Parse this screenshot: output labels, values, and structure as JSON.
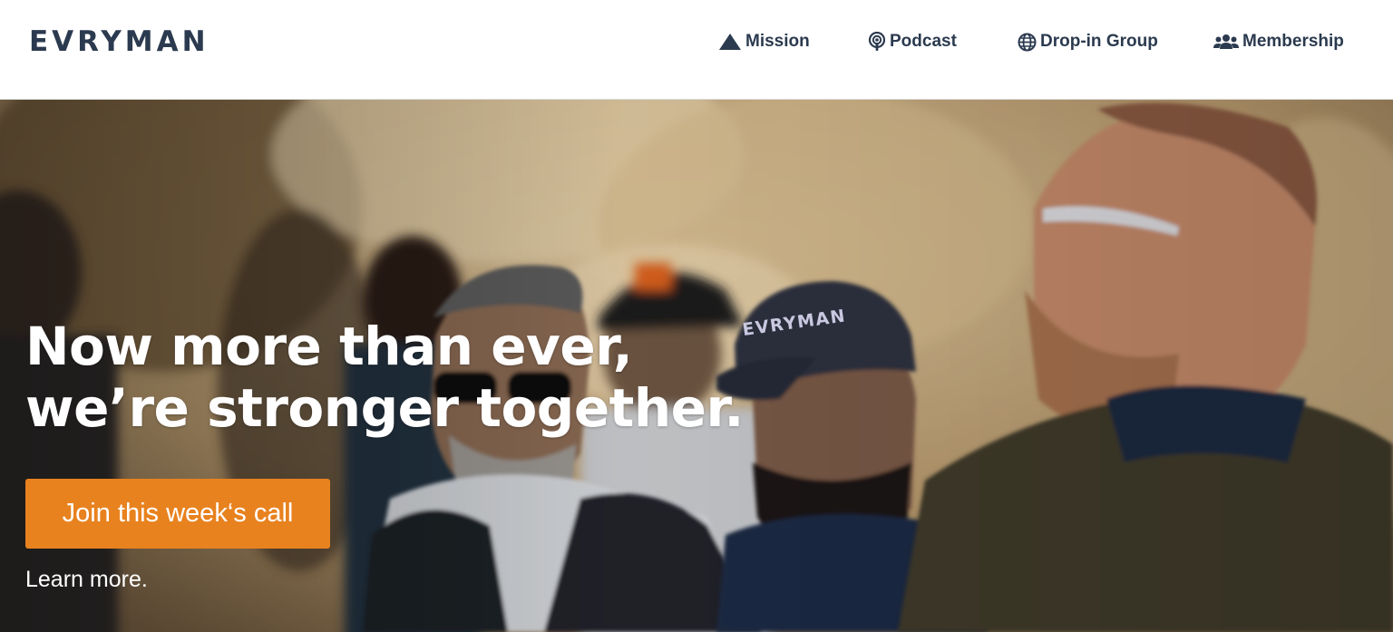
{
  "header": {
    "logo": "EVRYMAN",
    "nav": [
      {
        "label": "Mission",
        "icon": "mountain-icon"
      },
      {
        "label": "Podcast",
        "icon": "podcast-icon"
      },
      {
        "label": "Drop-in Group",
        "icon": "globe-icon"
      },
      {
        "label": "Membership",
        "icon": "users-icon"
      }
    ]
  },
  "hero": {
    "headline_line1": "Now more than ever,",
    "headline_line2": "we’re stronger together.",
    "cta_label": "Join this week‘s call",
    "learn_more": "Learn more.",
    "cap_text": "EVRYMAN"
  },
  "colors": {
    "brand_navy": "#2b3a4f",
    "cta_orange": "#e8821f",
    "text_white": "#ffffff"
  }
}
